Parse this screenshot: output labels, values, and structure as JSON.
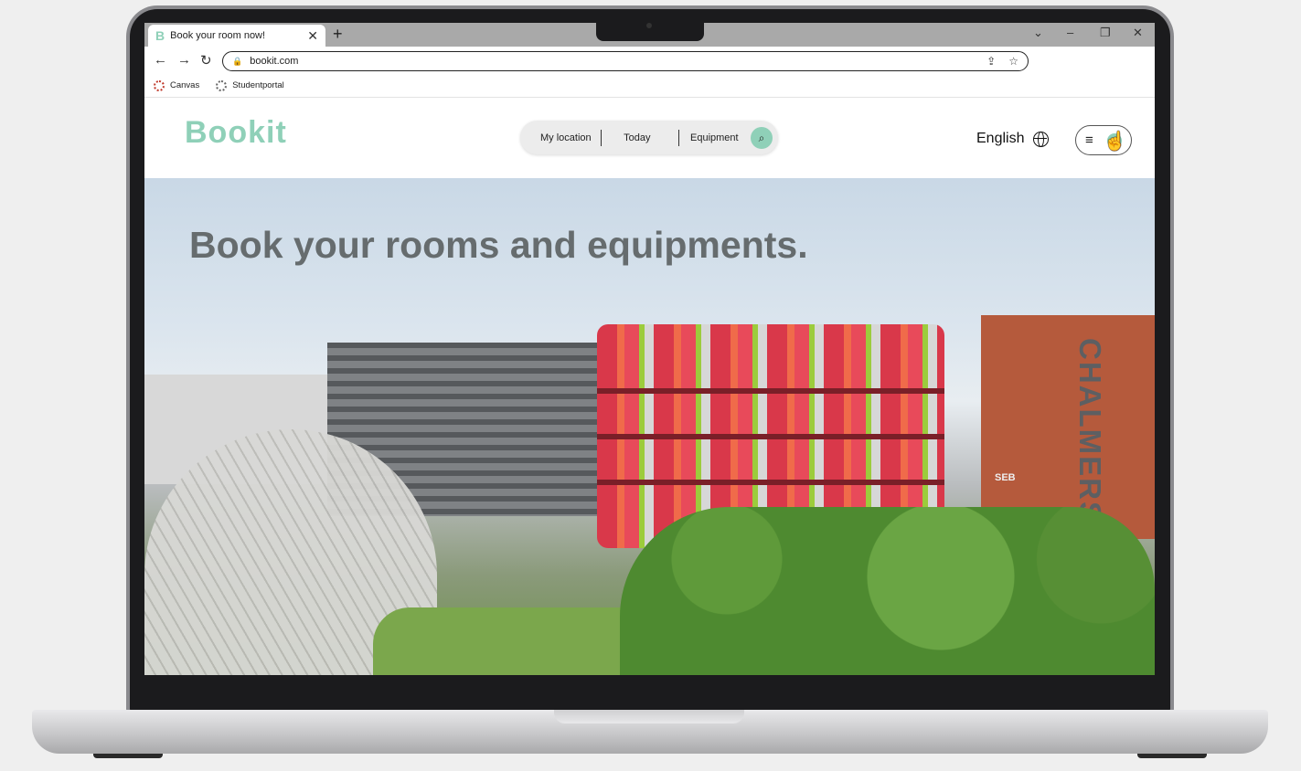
{
  "browser": {
    "tab_title": "Book your room now!",
    "tab_favicon": "B",
    "url": "bookit.com",
    "bookmarks": [
      {
        "label": "Canvas",
        "icon": "canvas-icon"
      },
      {
        "label": "Studentportal",
        "icon": "studentportal-icon"
      }
    ]
  },
  "header": {
    "logo": "Bookit",
    "search": {
      "location_label": "My location",
      "date_label": "Today",
      "equipment_label": "Equipment"
    },
    "language": "English"
  },
  "hero": {
    "title": "Book your rooms and equipments.",
    "sign_chalmers": "CHALMERS",
    "sign_seb": "SEB"
  },
  "colors": {
    "brand": "#8fd0b8",
    "title_grey": "#666c6e"
  }
}
